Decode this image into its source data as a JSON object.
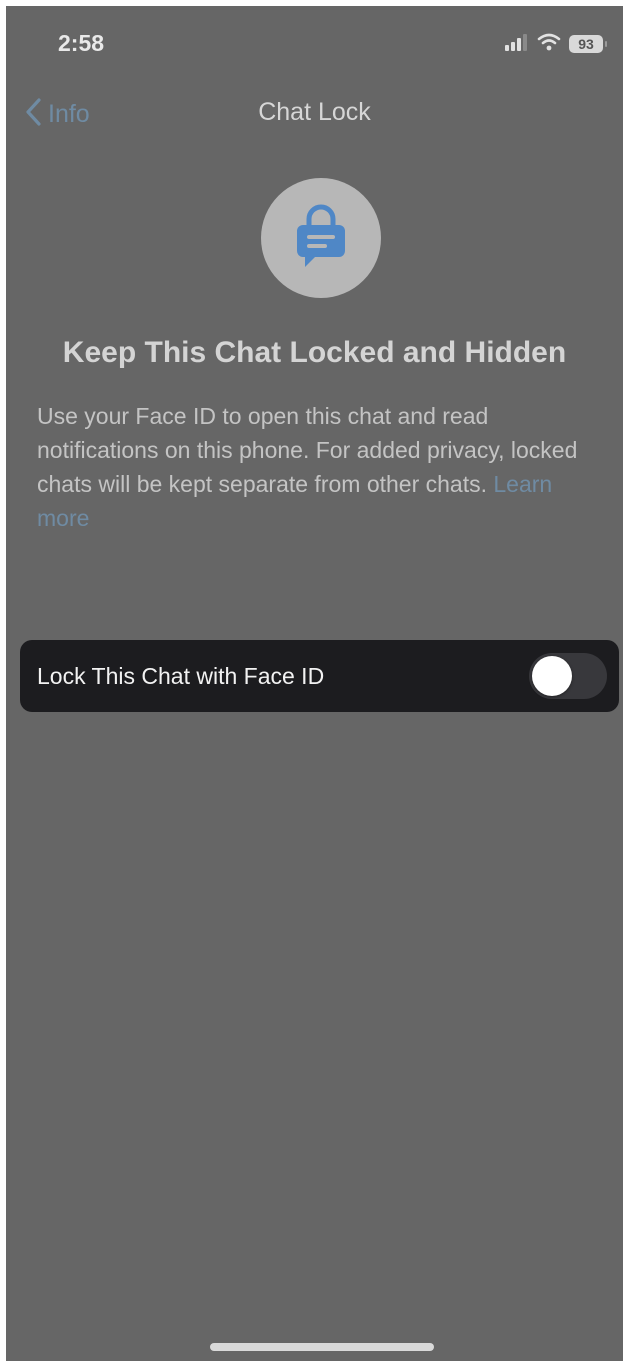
{
  "status_bar": {
    "time": "2:58",
    "battery": "93",
    "icons": [
      "cellular-signal-icon",
      "wifi-icon",
      "battery-icon"
    ]
  },
  "nav": {
    "back_label": "Info",
    "title": "Chat Lock",
    "back_icon": "chevron-left-icon"
  },
  "hero": {
    "icon": "lock-chat-icon",
    "headline": "Keep This Chat Locked and Hidden",
    "description": "Use your Face ID to open this chat and read notifications on this phone. For added privacy, locked chats will be kept separate from other chats.",
    "learn_more": "Learn more"
  },
  "settings": {
    "lock_label": "Lock This Chat with Face ID",
    "lock_enabled": false
  },
  "colors": {
    "background": "#666666",
    "accent": "#6f8ba3",
    "row_background": "#1c1c1f",
    "lock_icon": "#4f87c6"
  }
}
